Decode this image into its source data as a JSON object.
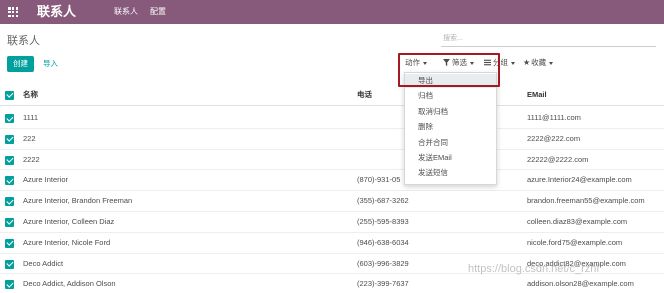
{
  "navbar": {
    "app_title": "联系人",
    "menu": [
      {
        "label": "联系人"
      },
      {
        "label": "配置"
      }
    ]
  },
  "breadcrumb": "联系人",
  "search": {
    "placeholder": "搜索...",
    "value": ""
  },
  "buttons": {
    "create": "创建",
    "import": "导入"
  },
  "toolbar": {
    "action": "动作",
    "filter": "筛选",
    "group": "分组",
    "favorites": "收藏"
  },
  "action_menu": {
    "items": [
      "导出",
      "归档",
      "取消归档",
      "删除",
      "合并合同",
      "发送EMail",
      "发送短信"
    ],
    "active_index": 0
  },
  "table": {
    "columns": [
      "名称",
      "电话",
      "EMail"
    ],
    "rows": [
      {
        "name": "1111",
        "phone": "",
        "email": "1111@1111.com"
      },
      {
        "name": "222",
        "phone": "",
        "email": "2222@222.com"
      },
      {
        "name": "2222",
        "phone": "",
        "email": "22222@2222.com"
      },
      {
        "name": "Azure Interior",
        "phone": "(870)-931-05",
        "email": "azure.Interior24@example.com"
      },
      {
        "name": "Azure Interior, Brandon Freeman",
        "phone": "(355)-687-3262",
        "email": "brandon.freeman55@example.com"
      },
      {
        "name": "Azure Interior, Colleen Diaz",
        "phone": "(255)-595-8393",
        "email": "colleen.diaz83@example.com"
      },
      {
        "name": "Azure Interior, Nicole Ford",
        "phone": "(946)-638-6034",
        "email": "nicole.ford75@example.com"
      },
      {
        "name": "Deco Addict",
        "phone": "(603)-996-3829",
        "email": "deco.addict82@example.com"
      },
      {
        "name": "Deco Addict, Addison Olson",
        "phone": "(223)-399-7637",
        "email": "addison.olson28@example.com"
      }
    ]
  },
  "watermark": "https://blog.csdn.net/c_rzhf",
  "colors": {
    "navbar": "#875a7b",
    "accent": "#00a09d",
    "highlight_box": "#a51a22"
  }
}
